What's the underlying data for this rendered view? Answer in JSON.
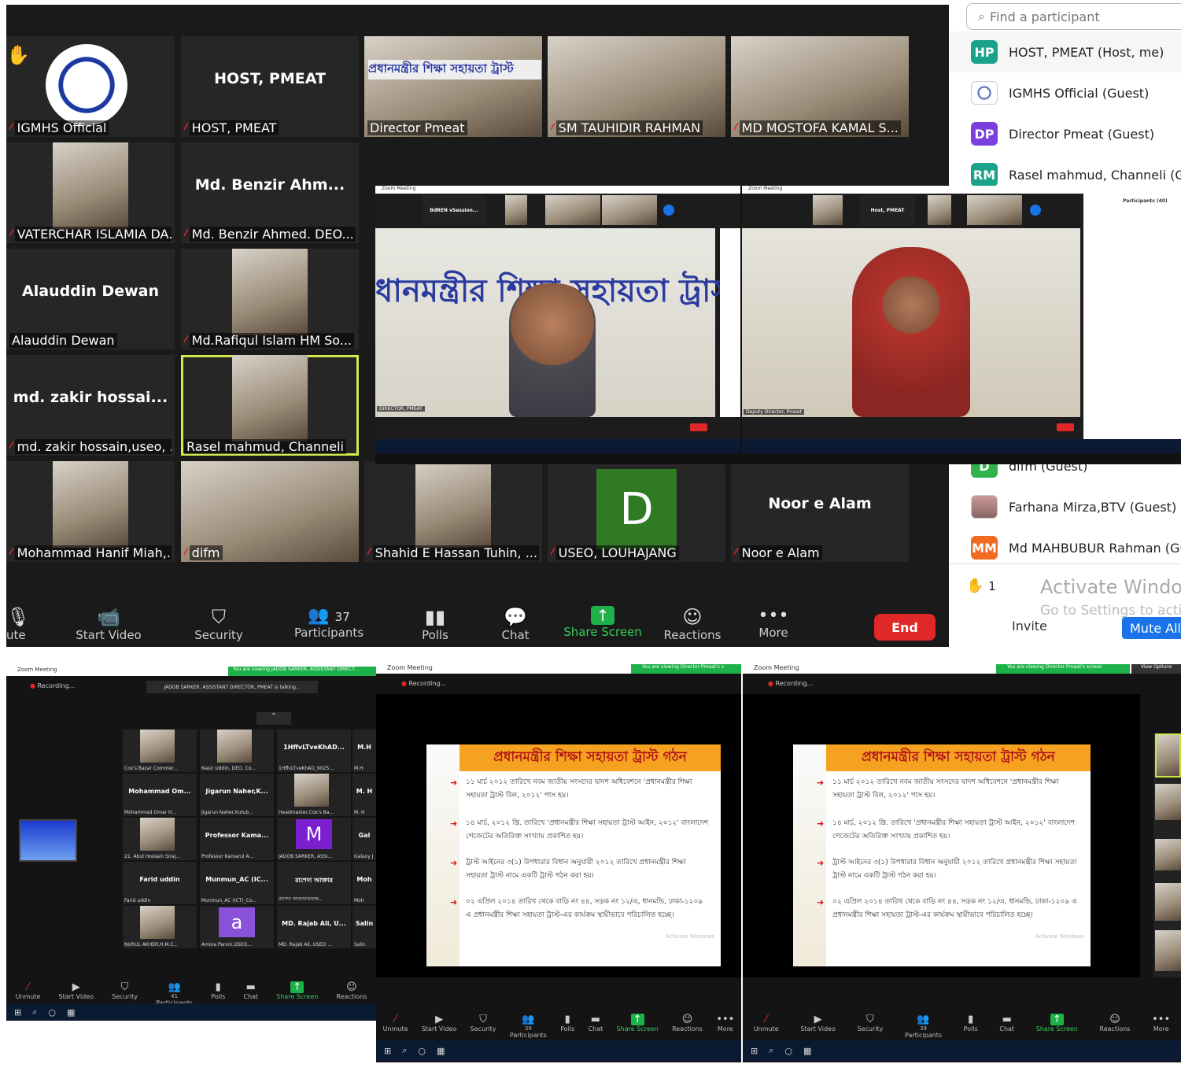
{
  "top_gallery": {
    "search_placeholder": "Find a participant",
    "tiles": [
      {
        "big": "",
        "name": "IGMHS Official"
      },
      {
        "big": "HOST, PMEAT",
        "name": "HOST, PMEAT"
      },
      {
        "big": "",
        "name": "Director Pmeat"
      },
      {
        "big": "",
        "name": "SM TAUHIDIR RAHMAN"
      },
      {
        "big": "",
        "name": "MD MOSTOFA KAMAL S..."
      },
      {
        "big": "",
        "name": "VATERCHAR ISLAMIA DA..."
      },
      {
        "big": "Md. Benzir Ahm...",
        "name": "Md. Benzir Ahmed. DEO..."
      },
      {
        "big": "Alauddin Dewan",
        "name": "Alauddin Dewan"
      },
      {
        "big": "",
        "name": "Md.Rafiqul Islam HM So..."
      },
      {
        "big": "md. zakir hossai...",
        "name": "md. zakir hossain,useo, ..."
      },
      {
        "big": "",
        "name": "Rasel mahmud, Channeli"
      },
      {
        "big": "",
        "name": "Mohammad Hanif Miah,..."
      },
      {
        "big": "",
        "name": "difm"
      },
      {
        "big": "",
        "name": "Shahid E Hassan Tuhin, ..."
      },
      {
        "big": "D",
        "name": "USEO, LOUHAJANG"
      },
      {
        "big": "Noor e  Alam",
        "name": "Noor e  Alam"
      }
    ],
    "slide_title": "প্রধানমন্ত্রীর শিক্ষা সহায়তা ট্রাস্ট",
    "toolbar": {
      "unmute": "ute",
      "start_video": "Start Video",
      "security": "Security",
      "participants": "Participants",
      "participants_count": "37",
      "polls": "Polls",
      "chat": "Chat",
      "share_screen": "Share Screen",
      "reactions": "Reactions",
      "more": "More",
      "end": "End"
    }
  },
  "participants_panel": {
    "items": [
      {
        "initials": "HP",
        "color": "#1aa38a",
        "label": "HOST, PMEAT (Host, me)"
      },
      {
        "initials": "",
        "color": "#ffffff",
        "label": "IGMHS Official (Guest)"
      },
      {
        "initials": "DP",
        "color": "#7b3fe0",
        "label": "Director Pmeat (Guest)"
      },
      {
        "initials": "RM",
        "color": "#1aa38a",
        "label": "Rasel mahmud, Channeli (Gue"
      }
    ],
    "items_lower": [
      {
        "initials": "D",
        "color": "#2fb34a",
        "label": "difm (Guest)"
      },
      {
        "initials": "",
        "color": "#c99",
        "label": "Farhana Mirza,BTV (Guest)"
      },
      {
        "initials": "MM",
        "color": "#f06a22",
        "label": "Md MAHBUBUR Rahman (Gu"
      }
    ],
    "raised_count": "1",
    "activate_line1": "Activate Windo",
    "activate_line2": "Go to Settings to acti",
    "invite": "Invite",
    "mute_all": "Mute All"
  },
  "inset_left": {
    "window_title": "Zoom Meeting",
    "top_tile": "BdREN vSession...",
    "slide_text": "ধানমন্ত্রীর শিক্ষা সহায়তা ট্রাস",
    "speaker_label": "DIRECTOR, PMEAT"
  },
  "inset_right": {
    "window_title": "Zoom Meeting",
    "top_tile": "Host, PMEAT",
    "panel_title": "Participants (40)",
    "speaker_label": "Deputy Director, Pmeat"
  },
  "bottom_left": {
    "window_title": "Zoom Meeting",
    "banner": "You are viewing JADOB SARKER, ASSISTANT DIRECT...",
    "recording": "Recording...",
    "talking": "JADOB SARKER, ASSISTANT DIRECTOR, PMEAT is talking...",
    "tiles": [
      {
        "big": "",
        "name": "Cox's Bazar Commer..."
      },
      {
        "big": "",
        "name": "Nasir Uddin, DEO, Co..."
      },
      {
        "big": "1HffvLTveKhAD...",
        "name": "1HffvLTveKhAD_9025..."
      },
      {
        "big": "M.H",
        "name": "M.H"
      },
      {
        "big": "Mohammad Om...",
        "name": "Mohammad Omar H..."
      },
      {
        "big": "Jigarun Naher,K...",
        "name": "Jigarun Naher,Kutub..."
      },
      {
        "big": "",
        "name": "Headmaster,Cox's Ba..."
      },
      {
        "big": "M. H",
        "name": "M. H"
      },
      {
        "big": "",
        "name": "21. Abul Hossain Siraj..."
      },
      {
        "big": "Professor Kama...",
        "name": "Professor Kamarul A..."
      },
      {
        "big": "M",
        "name": "JADOB SARKER, ASSI..."
      },
      {
        "big": "Gal",
        "name": "Galaxy J"
      },
      {
        "big": "Farid uddin",
        "name": "Farid uddin"
      },
      {
        "big": "Munmun_AC (IC...",
        "name": "Munmun_AC (ICT)_Co..."
      },
      {
        "big": "রাশেদা আক্তার",
        "name": "রাশেদা আক্তারঅধ্যক্ষ..."
      },
      {
        "big": "Moh",
        "name": "Moh"
      },
      {
        "big": "",
        "name": "NURUL AKHER,H.M.C..."
      },
      {
        "big": "a",
        "name": "Amina Parvin,USEO,..."
      },
      {
        "big": "MD. Rajab Ali, U...",
        "name": "MD. Rajab Ali, USEO ..."
      },
      {
        "big": "Salin",
        "name": "Salin"
      }
    ],
    "participants_count": "41"
  },
  "bottom_mid": {
    "window_title": "Zoom Meeting",
    "banner": "You are viewing Director Pmeat's s",
    "recording": "Recording...",
    "participants_count": "39"
  },
  "bottom_right": {
    "window_title": "Zoom Meeting",
    "banner": "You are viewing Director Pmeat's screen",
    "view_options": "View Options",
    "recording": "Recording...",
    "participants_count": "39"
  },
  "slide": {
    "title": "প্রধানমন্ত্রীর শিক্ষা সহায়তা ট্রাস্ট গঠন",
    "bullets": [
      "১১ মার্চ ২০১২ তারিখে নবম জাতীয় সংসদের দ্বাদশ অধিবেশনে 'প্রধানমন্ত্রীর শিক্ষা সহায়তা ট্রাস্ট বিল, ২০১২' পাস হয়।",
      "১৪ মার্চ, ২০১২ খ্রি. তারিখে 'প্রধানমন্ত্রীর শিক্ষা সহায়তা ট্রাস্ট আইন, ২০১২' বাংলাদেশ গেজেটের অতিরিক্ত সংখ্যায় প্রকাশিত হয়।",
      "ট্রাস্ট আইনের ৩(১) উপধারার বিধান অনুযায়ী ২০১২ তারিখে প্রধানমন্ত্রীর শিক্ষা সহায়তা ট্রাস্ট নামে একটি ট্রাস্ট গঠন করা হয়।",
      "০২ এপ্রিল ২০১৪ তারিখ থেকে বাড়ি নং ৪৪, সড়ক নং ১২/এ, ধানমন্ডি, ঢাকা-১২০৯ এ প্রধানমন্ত্রীর শিক্ষা সহায়তা ট্রাস্ট-এর কার্যক্রম স্থায়ীভাবে পরিচালিত হচ্ছে।"
    ],
    "watermark": "Activate Windows"
  },
  "small_toolbar": {
    "unmute": "Unmute",
    "start_video": "Start Video",
    "security": "Security",
    "participants": "Participants",
    "polls": "Polls",
    "chat": "Chat",
    "share_screen": "Share Screen",
    "reactions": "Reactions",
    "more": "More"
  }
}
